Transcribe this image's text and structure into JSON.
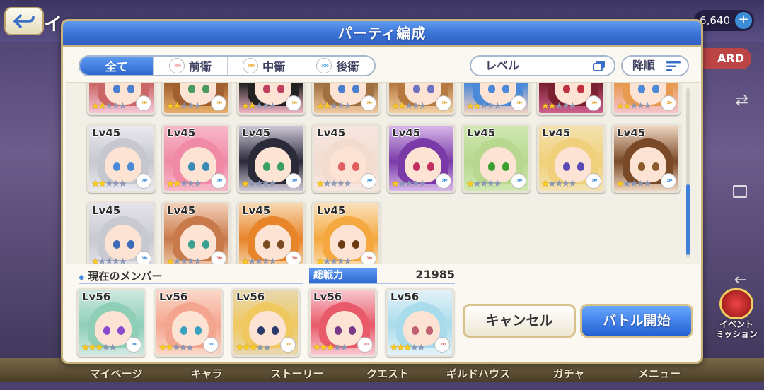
{
  "background": {
    "top_partial_text": "イ",
    "currency": "6,640",
    "currency_plus": "+",
    "card_button": "ARD",
    "event_mission_line1": "イベント",
    "event_mission_line2": "ミッション",
    "nav": [
      "マイページ",
      "キャラ",
      "ストーリー",
      "クエスト",
      "ギルドハウス",
      "ガチャ",
      "メニュー"
    ]
  },
  "dialog": {
    "title": "パーティ編成",
    "tabs": [
      {
        "label": "全て",
        "active": true
      },
      {
        "label": "前衛",
        "active": false
      },
      {
        "label": "中衛",
        "active": false
      },
      {
        "label": "後衛",
        "active": false
      }
    ],
    "sort_label": "レベル",
    "order_label": "降順",
    "roster": [
      {
        "level": "",
        "stars": 2,
        "rank": "mid",
        "palette": [
          "#f5c8d8",
          "#c66",
          "#4a7fd0"
        ]
      },
      {
        "level": "",
        "stars": 2,
        "rank": "mid",
        "palette": [
          "#e9b06a",
          "#a06030",
          "#4a9a60"
        ]
      },
      {
        "level": "",
        "stars": 2,
        "rank": "mid",
        "palette": [
          "#f0b6c4",
          "#222",
          "#c04060"
        ]
      },
      {
        "level": "",
        "stars": 2,
        "rank": "mid",
        "palette": [
          "#f2c9a0",
          "#a07040",
          "#4a7fd0"
        ]
      },
      {
        "level": "",
        "stars": 2,
        "rank": "mid",
        "palette": [
          "#f3d2a5",
          "#b67a40",
          "#7070c0"
        ]
      },
      {
        "level": "",
        "stars": 2,
        "rank": "mid",
        "palette": [
          "#f1d0c0",
          "#4a8ad8",
          "#4a8ad8"
        ]
      },
      {
        "level": "",
        "stars": 2,
        "rank": "mid",
        "palette": [
          "#d06090",
          "#7a2030",
          "#c03040"
        ]
      },
      {
        "level": "",
        "stars": 2,
        "rank": "mid",
        "palette": [
          "#f6c4d0",
          "#e89a50",
          "#4a8ad8"
        ]
      },
      {
        "level": "Lv45",
        "stars": 2,
        "rank": "back",
        "palette": [
          "#e9e9ef",
          "#c7c7cf",
          "#4a8ad8"
        ]
      },
      {
        "level": "Lv45",
        "stars": 2,
        "rank": "back",
        "palette": [
          "#f7b8c8",
          "#f08aa6",
          "#3a8ab8"
        ]
      },
      {
        "level": "Lv45",
        "stars": 1,
        "rank": "back",
        "palette": [
          "#cfc8d8",
          "#2a2a38",
          "#3aa060"
        ]
      },
      {
        "level": "Lv45",
        "stars": 1,
        "rank": "back",
        "palette": [
          "#f7e6e0",
          "#f2dcd0",
          "#e06060"
        ]
      },
      {
        "level": "Lv45",
        "stars": 1,
        "rank": "back",
        "palette": [
          "#d7b8e8",
          "#7a3aa8",
          "#c03060"
        ]
      },
      {
        "level": "Lv45",
        "stars": 1,
        "rank": "back",
        "palette": [
          "#cfe8b0",
          "#b8d890",
          "#3aa030"
        ]
      },
      {
        "level": "Lv45",
        "stars": 1,
        "rank": "back",
        "palette": [
          "#f3e2b0",
          "#f0d07a",
          "#5a4ab8"
        ]
      },
      {
        "level": "Lv45",
        "stars": 1,
        "rank": "back",
        "palette": [
          "#efd6c0",
          "#7a4a28",
          "#8a5a2a"
        ]
      },
      {
        "level": "Lv45",
        "stars": 1,
        "rank": "back",
        "palette": [
          "#e4e4ea",
          "#c9c9d2",
          "#3a6ab8"
        ]
      },
      {
        "level": "Lv45",
        "stars": 1,
        "rank": "front",
        "palette": [
          "#f3d0b8",
          "#c97a4a",
          "#3aa090"
        ]
      },
      {
        "level": "Lv45",
        "stars": 1,
        "rank": "front",
        "palette": [
          "#f8d8b0",
          "#e8852a",
          "#7a4a20"
        ]
      },
      {
        "level": "Lv45",
        "stars": 1,
        "rank": "front",
        "palette": [
          "#fae0b8",
          "#f5a840",
          "#6a3a10"
        ]
      }
    ],
    "members_label": "現在のメンバー",
    "power_label": "総戦力",
    "power_value": "21985",
    "members": [
      {
        "level": "Lv56",
        "stars": 3,
        "rank": "back",
        "palette": [
          "#cfe8e0",
          "#8fcfb8",
          "#8a4ad0"
        ]
      },
      {
        "level": "Lv56",
        "stars": 2,
        "rank": "back",
        "palette": [
          "#fbd8c8",
          "#f4a590",
          "#3aa0c0"
        ]
      },
      {
        "level": "Lv56",
        "stars": 3,
        "rank": "mid",
        "palette": [
          "#e8d8b0",
          "#f0c860",
          "#2a3a6a"
        ]
      },
      {
        "level": "Lv56",
        "stars": 3,
        "rank": "front",
        "palette": [
          "#f8c8d0",
          "#e85a6a",
          "#7a3a8a"
        ]
      },
      {
        "level": "Lv56",
        "stars": 3,
        "rank": "front",
        "palette": [
          "#e4f2f8",
          "#a8dcec",
          "#c06070"
        ]
      }
    ],
    "cancel_label": "キャンセル",
    "start_label": "バトル開始"
  },
  "colors": {
    "header_blue": "#3a72d6",
    "accent_gold": "#c7b27a",
    "star_gold": "#ffcc1a",
    "scroll_thumb": "#3f7fdc"
  }
}
